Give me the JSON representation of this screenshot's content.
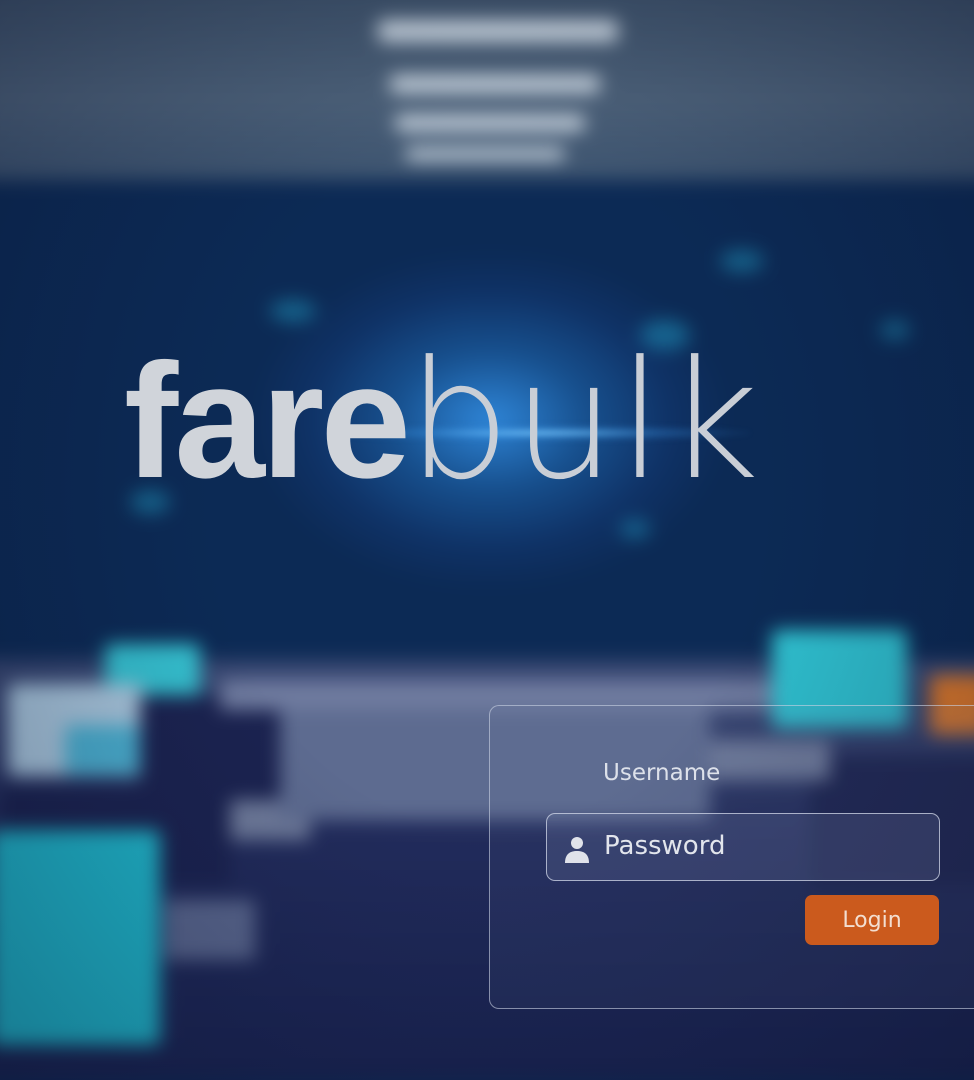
{
  "brand": {
    "logo_bold": "fare",
    "logo_light": "bulk"
  },
  "login": {
    "username_label": "Username",
    "password_placeholder": "Password",
    "login_button_label": "Login"
  },
  "icons": {
    "field_icon": "user-icon"
  },
  "colors": {
    "accent": "#cb5a1d",
    "logo_text": "#d0d4da",
    "backdrop": "#0f2a55"
  }
}
